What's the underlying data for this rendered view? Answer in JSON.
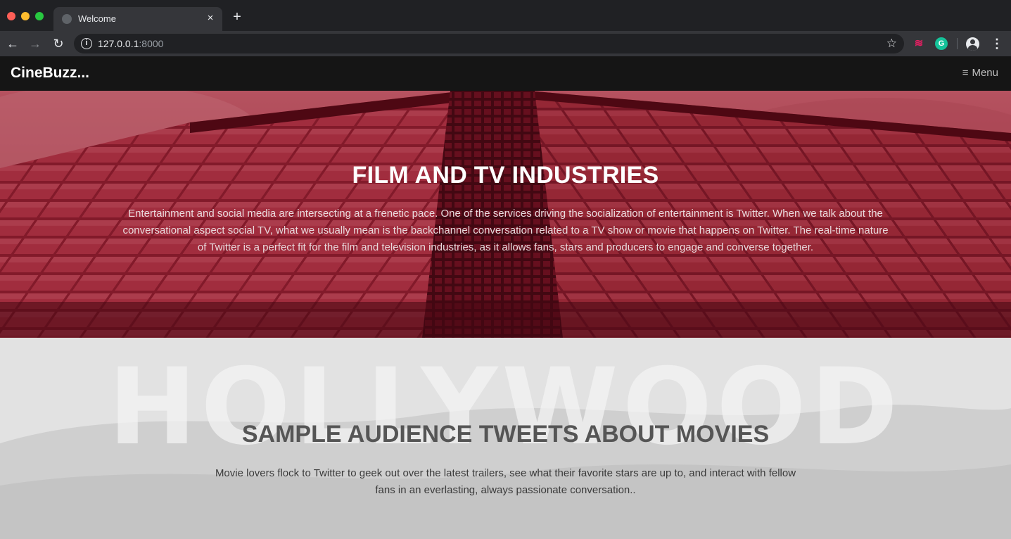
{
  "browser": {
    "tab_title": "Welcome",
    "tab_close": "×",
    "new_tab": "+",
    "url_host": "127.0.0.1",
    "url_port": ":8000",
    "back": "←",
    "forward": "→",
    "reload": "↻",
    "info": "i",
    "star": "☆",
    "kebab": "⋮",
    "ext_g": "G",
    "ext_feed": "≋"
  },
  "navbar": {
    "brand": "CineBuzz...",
    "menu_label": "Menu",
    "menu_icon": "≡"
  },
  "hero": {
    "title": "FILM AND TV INDUSTRIES",
    "text": "Entertainment and social media are intersecting at a frenetic pace. One of the services driving the socialization of entertainment is Twitter. When we talk about the conversational aspect social TV, what we usually mean is the backchannel conversation related to a TV show or movie that happens on Twitter. The real-time nature of Twitter is a perfect fit for the film and television industries, as it allows fans, stars and producers to engage and converse together."
  },
  "tweets": {
    "title": "SAMPLE AUDIENCE TWEETS ABOUT MOVIES",
    "text": "Movie lovers flock to Twitter to geek out over the latest trailers, see what their favorite stars are up to, and interact with fellow fans in an everlasting, always passionate conversation..",
    "background_sign": "HOLLYWOOD"
  },
  "colors": {
    "chrome_dark": "#202124",
    "chrome_toolbar": "#35363a",
    "navbar_bg": "#151515",
    "hero_red": "#8a2233",
    "tweets_bg": "#dcdcdc"
  }
}
